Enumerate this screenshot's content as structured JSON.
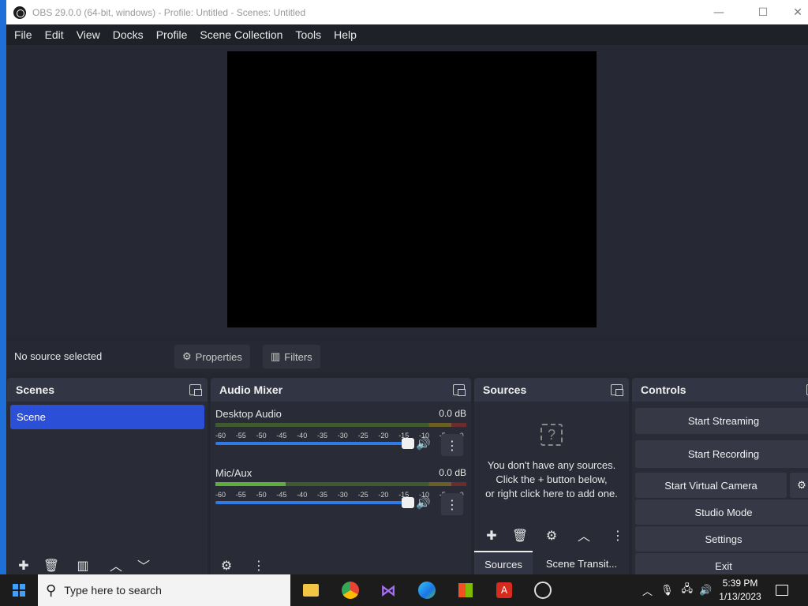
{
  "window": {
    "title": "OBS 29.0.0 (64-bit, windows) - Profile: Untitled - Scenes: Untitled",
    "controls": {
      "minimize": "—",
      "maximize": "☐",
      "close": "✕"
    }
  },
  "menu": [
    "File",
    "Edit",
    "View",
    "Docks",
    "Profile",
    "Scene Collection",
    "Tools",
    "Help"
  ],
  "source_bar": {
    "status": "No source selected",
    "properties_label": "Properties",
    "filters_label": "Filters"
  },
  "scenes": {
    "title": "Scenes",
    "items": [
      "Scene"
    ]
  },
  "audio_mixer": {
    "title": "Audio Mixer",
    "ticks": [
      "-60",
      "-55",
      "-50",
      "-45",
      "-40",
      "-35",
      "-30",
      "-25",
      "-20",
      "-15",
      "-10",
      "-5",
      "0"
    ],
    "channels": [
      {
        "name": "Desktop Audio",
        "db": "0.0 dB",
        "level": 0.0
      },
      {
        "name": "Mic/Aux",
        "db": "0.0 dB",
        "level": 0.28
      }
    ]
  },
  "sources": {
    "title": "Sources",
    "empty_line1": "You don't have any sources.",
    "empty_line2": "Click the + button below,",
    "empty_line3": "or right click here to add one.",
    "tabs": [
      "Sources",
      "Scene Transit..."
    ]
  },
  "controls": {
    "title": "Controls",
    "buttons": [
      "Start Streaming",
      "Start Recording",
      "Start Virtual Camera",
      "Studio Mode",
      "Settings",
      "Exit"
    ]
  },
  "taskbar": {
    "search_placeholder": "Type here to search",
    "time": "5:39 PM",
    "date": "1/13/2023"
  },
  "colors": {
    "accent": "#2b4fd6",
    "slider": "#2f7ae5",
    "meter_green": "#5dae3a"
  }
}
